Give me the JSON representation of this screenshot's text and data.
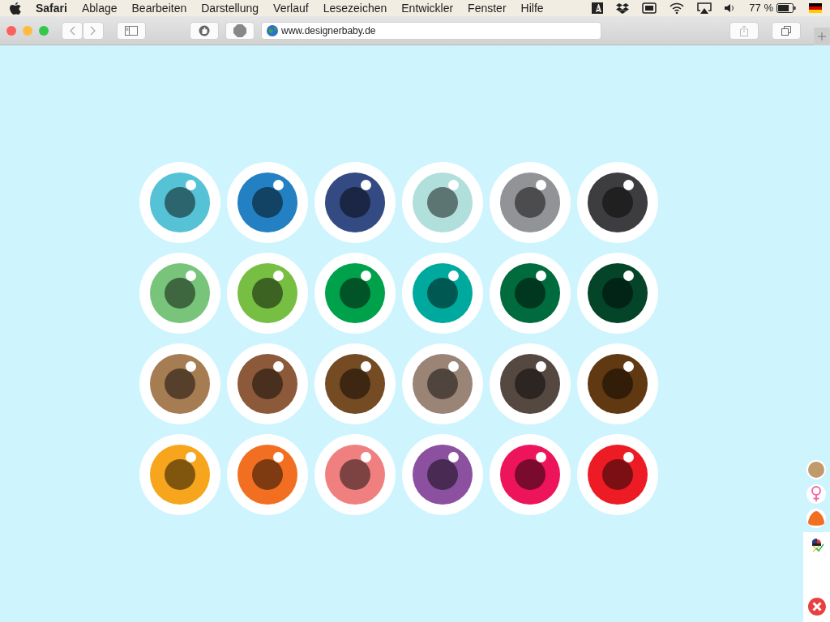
{
  "menu_bar": {
    "app": "Safari",
    "items": [
      "Ablage",
      "Bearbeiten",
      "Darstellung",
      "Verlauf",
      "Lesezeichen",
      "Entwickler",
      "Fenster",
      "Hilfe"
    ],
    "battery": {
      "reading": "77 %",
      "level": 0.77
    }
  },
  "toolbar": {
    "address": "www.designerbaby.de"
  },
  "eye_rows": [
    [
      {
        "color": "#56c2d6"
      },
      {
        "color": "#2380c3"
      },
      {
        "color": "#344a82"
      },
      {
        "color": "#b1dfdc"
      },
      {
        "color": "#929397"
      },
      {
        "color": "#3d3d3f"
      }
    ],
    [
      {
        "color": "#78c47a"
      },
      {
        "color": "#76bf43"
      },
      {
        "color": "#00a14b"
      },
      {
        "color": "#00a99d"
      },
      {
        "color": "#006b3c"
      },
      {
        "color": "#04452a"
      }
    ],
    [
      {
        "color": "#a67c52"
      },
      {
        "color": "#8c5a3a"
      },
      {
        "color": "#754b24"
      },
      {
        "color": "#9a8476"
      },
      {
        "color": "#554841"
      },
      {
        "color": "#603812"
      }
    ],
    [
      {
        "color": "#f7a51c"
      },
      {
        "color": "#f26f21"
      },
      {
        "color": "#f08080"
      },
      {
        "color": "#8b509f"
      },
      {
        "color": "#ed145b"
      },
      {
        "color": "#ed1c24"
      }
    ]
  ],
  "choices": [
    {
      "kind": "skin",
      "color": "#c19a6b"
    },
    {
      "kind": "gender",
      "color": "#f06aa8"
    },
    {
      "kind": "hair",
      "color": "#f26f21"
    }
  ]
}
